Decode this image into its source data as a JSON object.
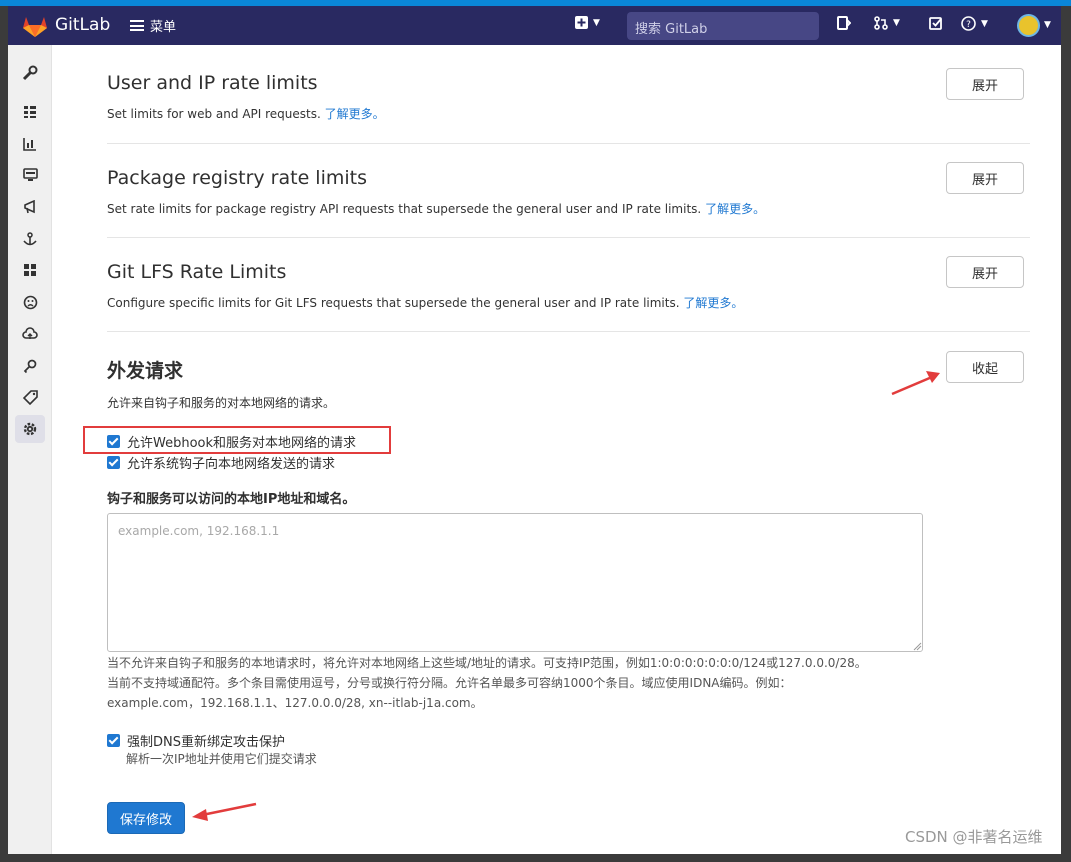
{
  "navbar": {
    "brand": "GitLab",
    "menu_label": "菜单",
    "search_placeholder": "搜索 GitLab"
  },
  "sections": [
    {
      "title": "User and IP rate limits",
      "desc": "Set limits for web and API requests.",
      "link": "了解更多。",
      "button": "展开"
    },
    {
      "title": "Package registry rate limits",
      "desc": "Set rate limits for package registry API requests that supersede the general user and IP rate limits.",
      "link": "了解更多。",
      "button": "展开"
    },
    {
      "title": "Git LFS Rate Limits",
      "desc": "Configure specific limits for Git LFS requests that supersede the general user and IP rate limits.",
      "link": "了解更多。",
      "button": "展开"
    }
  ],
  "outbound": {
    "title": "外发请求",
    "desc": "允许来自钩子和服务的对本地网络的请求。",
    "button": "收起",
    "allow_webhook": "允许Webhook和服务对本地网络的请求",
    "allow_system_hooks": "允许系统钩子向本地网络发送的请求",
    "field_label": "钩子和服务可以访问的本地IP地址和域名。",
    "placeholder": "example.com, 192.168.1.1",
    "help_line1": "当不允许来自钩子和服务的本地请求时，将允许对本地网络上这些域/地址的请求。可支持IP范围，例如1:0:0:0:0:0:0:0/124或127.0.0.0/28。",
    "help_line2": "当前不支持域通配符。多个条目需使用逗号，分号或换行符分隔。允许名单最多可容纳1000个条目。域应使用IDNA编码。例如：",
    "help_line3": "example.com，192.168.1.1、127.0.0.0/28, xn--itlab-j1a.com。",
    "dns_label": "强制DNS重新绑定攻击保护",
    "dns_sub": "解析一次IP地址并使用它们提交请求",
    "save": "保存修改"
  },
  "watermark": "CSDN @非著名运维",
  "colors": {
    "navbar": "#292961",
    "primary": "#1f78d1",
    "annotation": "#e23c3c"
  }
}
